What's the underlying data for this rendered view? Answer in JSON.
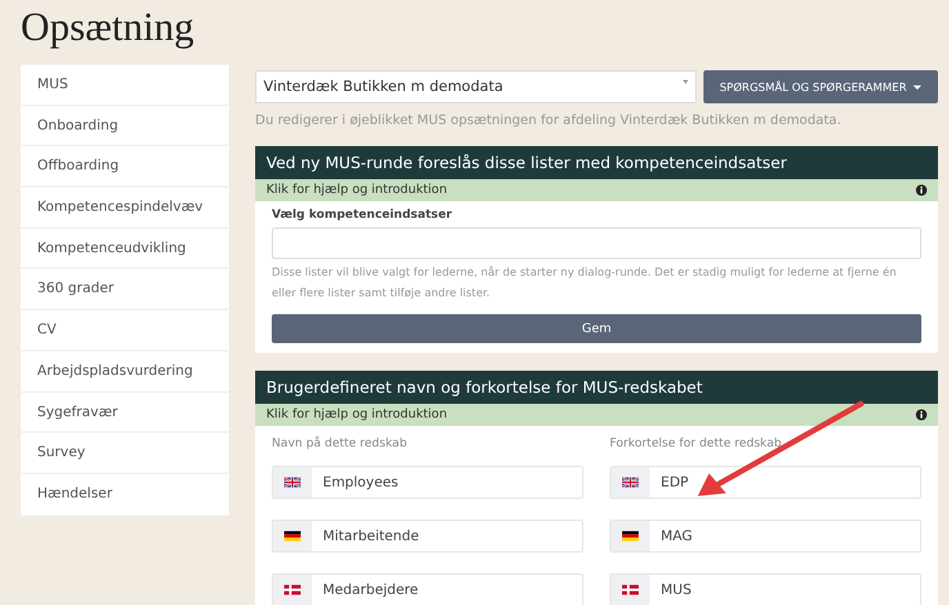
{
  "page_title": "Opsætning",
  "sidebar": {
    "items": [
      {
        "label": "MUS"
      },
      {
        "label": "Onboarding"
      },
      {
        "label": "Offboarding"
      },
      {
        "label": "Kompetencespindelvæv"
      },
      {
        "label": "Kompetenceudvikling"
      },
      {
        "label": "360 grader"
      },
      {
        "label": "CV"
      },
      {
        "label": "Arbejdspladsvurdering"
      },
      {
        "label": "Sygefravær"
      },
      {
        "label": "Survey"
      },
      {
        "label": "Hændelser"
      }
    ]
  },
  "department_select": {
    "value": "Vinterdæk Butikken m demodata"
  },
  "questions_button": {
    "label": "SPØRGSMÅL OG SPØRGERAMMER"
  },
  "info_text": "Du redigerer i øjeblikket MUS opsætningen for afdeling Vinterdæk Butikken m demodata.",
  "panels": [
    {
      "kind": "competence",
      "title": "Ved ny MUS-runde foreslås disse lister med kompetenceindsatser",
      "help": "Klik for hjælp og introduktion",
      "field_label": "Vælg kompetenceindsatser",
      "description": "Disse lister vil blive valgt for lederne, når de starter ny dialog-runde. Det er stadig muligt for lederne at fjerne én eller flere lister samt tilføje andre lister.",
      "button": "Gem"
    },
    {
      "kind": "names",
      "title": "Brugerdefineret navn og forkortelse for MUS-redskabet",
      "help": "Klik for hjælp og introduktion",
      "name_label": "Navn på dette redskab",
      "abbr_label": "Forkortelse for dette redskab",
      "rows": [
        {
          "kind": "uk",
          "name": "Employees",
          "abbr": "EDP"
        },
        {
          "kind": "de",
          "name": "Mitarbeitende",
          "abbr": "MAG"
        },
        {
          "kind": "dk",
          "name": "Medarbejdere",
          "abbr": "MUS"
        }
      ]
    }
  ]
}
